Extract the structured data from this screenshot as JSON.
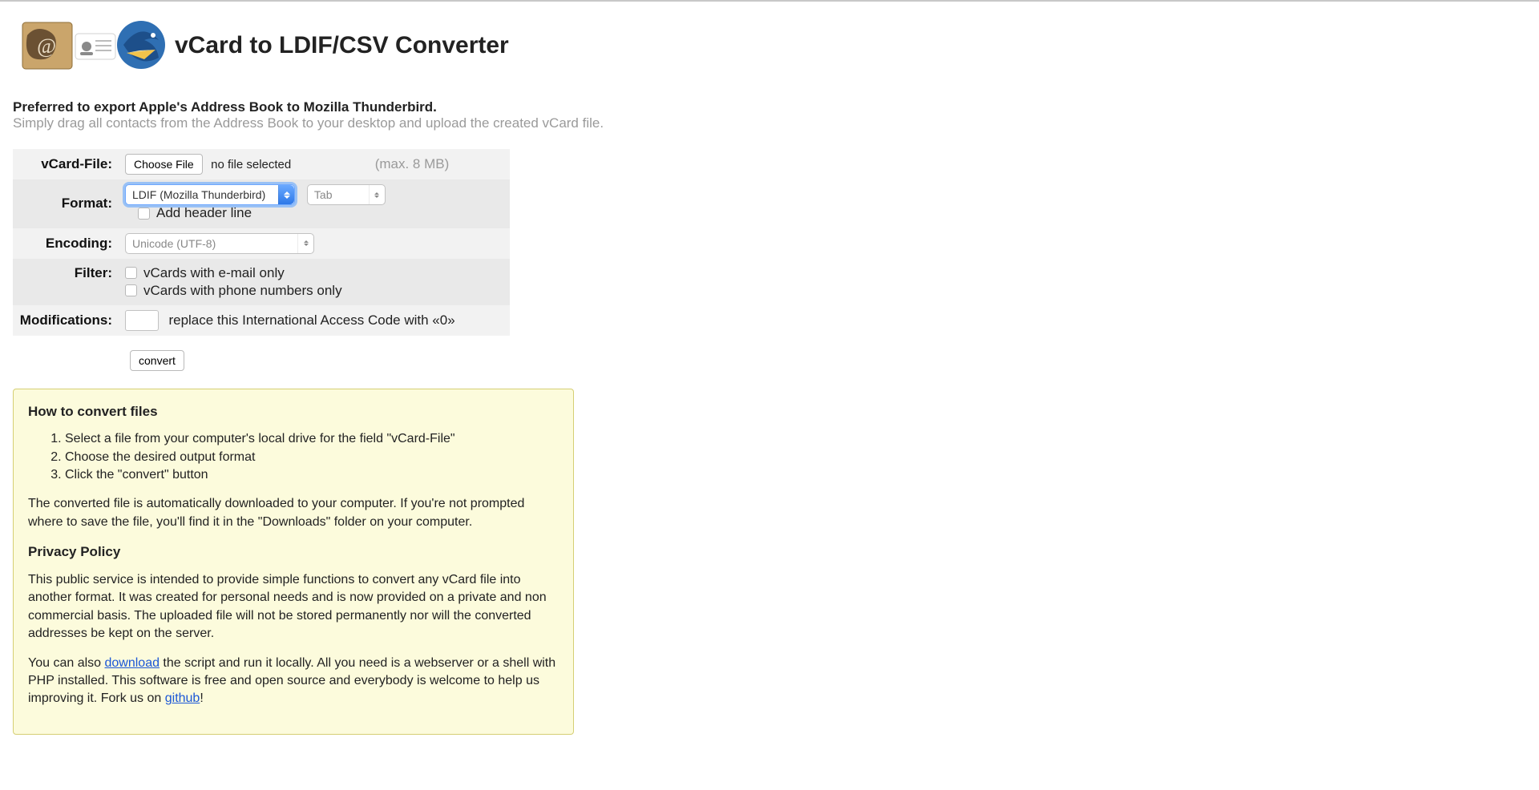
{
  "header": {
    "title": "vCard to LDIF/CSV Converter"
  },
  "intro": {
    "line1": "Preferred to export Apple's Address Book to Mozilla Thunderbird.",
    "line2": "Simply drag all contacts from the Address Book to your desktop and upload the created vCard file."
  },
  "form": {
    "vcard_label": "vCard-File:",
    "choose_file_label": "Choose File",
    "file_status": "no file selected",
    "max_hint": "(max. 8 MB)",
    "format_label": "Format:",
    "format_value": "LDIF (Mozilla Thunderbird)",
    "delimiter_value": "Tab",
    "add_header_label": "Add header line",
    "encoding_label": "Encoding:",
    "encoding_value": "Unicode (UTF-8)",
    "filter_label": "Filter:",
    "filter_email": "vCards with e-mail only",
    "filter_phone": "vCards with phone numbers only",
    "modifications_label": "Modifications:",
    "replace_text": "replace this International Access Code with «0»",
    "convert_label": "convert"
  },
  "info": {
    "howto_heading": "How to convert files",
    "steps": [
      "Select a file from your computer's local drive for the field \"vCard-File\"",
      "Choose the desired output format",
      "Click the \"convert\" button"
    ],
    "download_note": "The converted file is automatically downloaded to your computer. If you're not prompted where to save the file, you'll find it in the \"Downloads\" folder on your computer.",
    "privacy_heading": "Privacy Policy",
    "privacy_p1": "This public service is intended to provide simple functions to convert any vCard file into another format. It was created for personal needs and is now provided on a private and non commercial basis. The uploaded file will not be stored permanently nor will the converted addresses be kept on the server.",
    "local_pre": "You can also ",
    "download_link": "download",
    "local_mid": " the script and run it locally. All you need is a webserver or a shell with PHP installed. This software is free and open source and everybody is welcome to help us improving it. Fork us on ",
    "github_link": "github",
    "local_post": "!"
  }
}
